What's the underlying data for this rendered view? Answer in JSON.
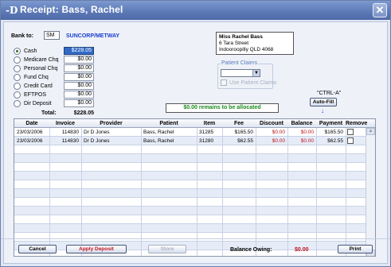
{
  "window": {
    "title": "Receipt: Bass, Rachel",
    "logo": "-D",
    "close": "✕"
  },
  "bank": {
    "label": "Bank to:",
    "code": "SM",
    "name": "SUNCORP/METWAY"
  },
  "payments": [
    {
      "label": "Cash",
      "amount": "$228.05",
      "selected": true
    },
    {
      "label": "Medicare Chq",
      "amount": "$0.00",
      "selected": false
    },
    {
      "label": "Personal Chq",
      "amount": "$0.00",
      "selected": false
    },
    {
      "label": "Fund Chq",
      "amount": "$0.00",
      "selected": false
    },
    {
      "label": "Credit Card",
      "amount": "$0.00",
      "selected": false
    },
    {
      "label": "EFTPOS",
      "amount": "$0.00",
      "selected": false
    },
    {
      "label": "Dir Deposit",
      "amount": "$0.00",
      "selected": false
    }
  ],
  "total": {
    "label": "Total:",
    "value": "$228.05"
  },
  "address": {
    "name": "Miss Rachel Bass",
    "line1": "6 Tara Street",
    "line2": "Indooroopilly QLD 4068"
  },
  "claims": {
    "title": "Patient Claims",
    "dropdown_value": "",
    "use_claims_label": "Use Patient Claims"
  },
  "allocation": {
    "message": "$0.00  remains to be allocated"
  },
  "autofill": {
    "hint": "\"CTRL-A\"",
    "button": "Auto-Fill",
    "arrow": "↓"
  },
  "table": {
    "headers": [
      "Date",
      "Invoice",
      "Provider",
      "Patient",
      "Item",
      "Fee",
      "Discount",
      "Balance",
      "Payment",
      "Remove"
    ],
    "rows": [
      {
        "date": "23/03/2006",
        "invoice": "114830",
        "provider": "Dr D Jones",
        "patient": "Bass, Rachel",
        "item": "31285",
        "fee": "$165.50",
        "discount": "$0.00",
        "balance": "$0.00",
        "payment": "$165.50"
      },
      {
        "date": "23/03/2006",
        "invoice": "114830",
        "provider": "Dr D Jones",
        "patient": "Bass, Rachel",
        "item": "31280",
        "fee": "$62.55",
        "discount": "$0.00",
        "balance": "$0.00",
        "payment": "$62.55"
      }
    ]
  },
  "footer": {
    "cancel": "Cancel",
    "apply_deposit": "Apply Deposit",
    "store": "Store",
    "balance_label": "Balance Owing:",
    "balance_value": "$0.00",
    "print": "Print"
  },
  "colors": {
    "title_bar": "#5b78b6",
    "accent_blue": "#1a3fcf",
    "red": "#c0131c",
    "green": "#1a8a1a",
    "selected": "#316ac5"
  }
}
